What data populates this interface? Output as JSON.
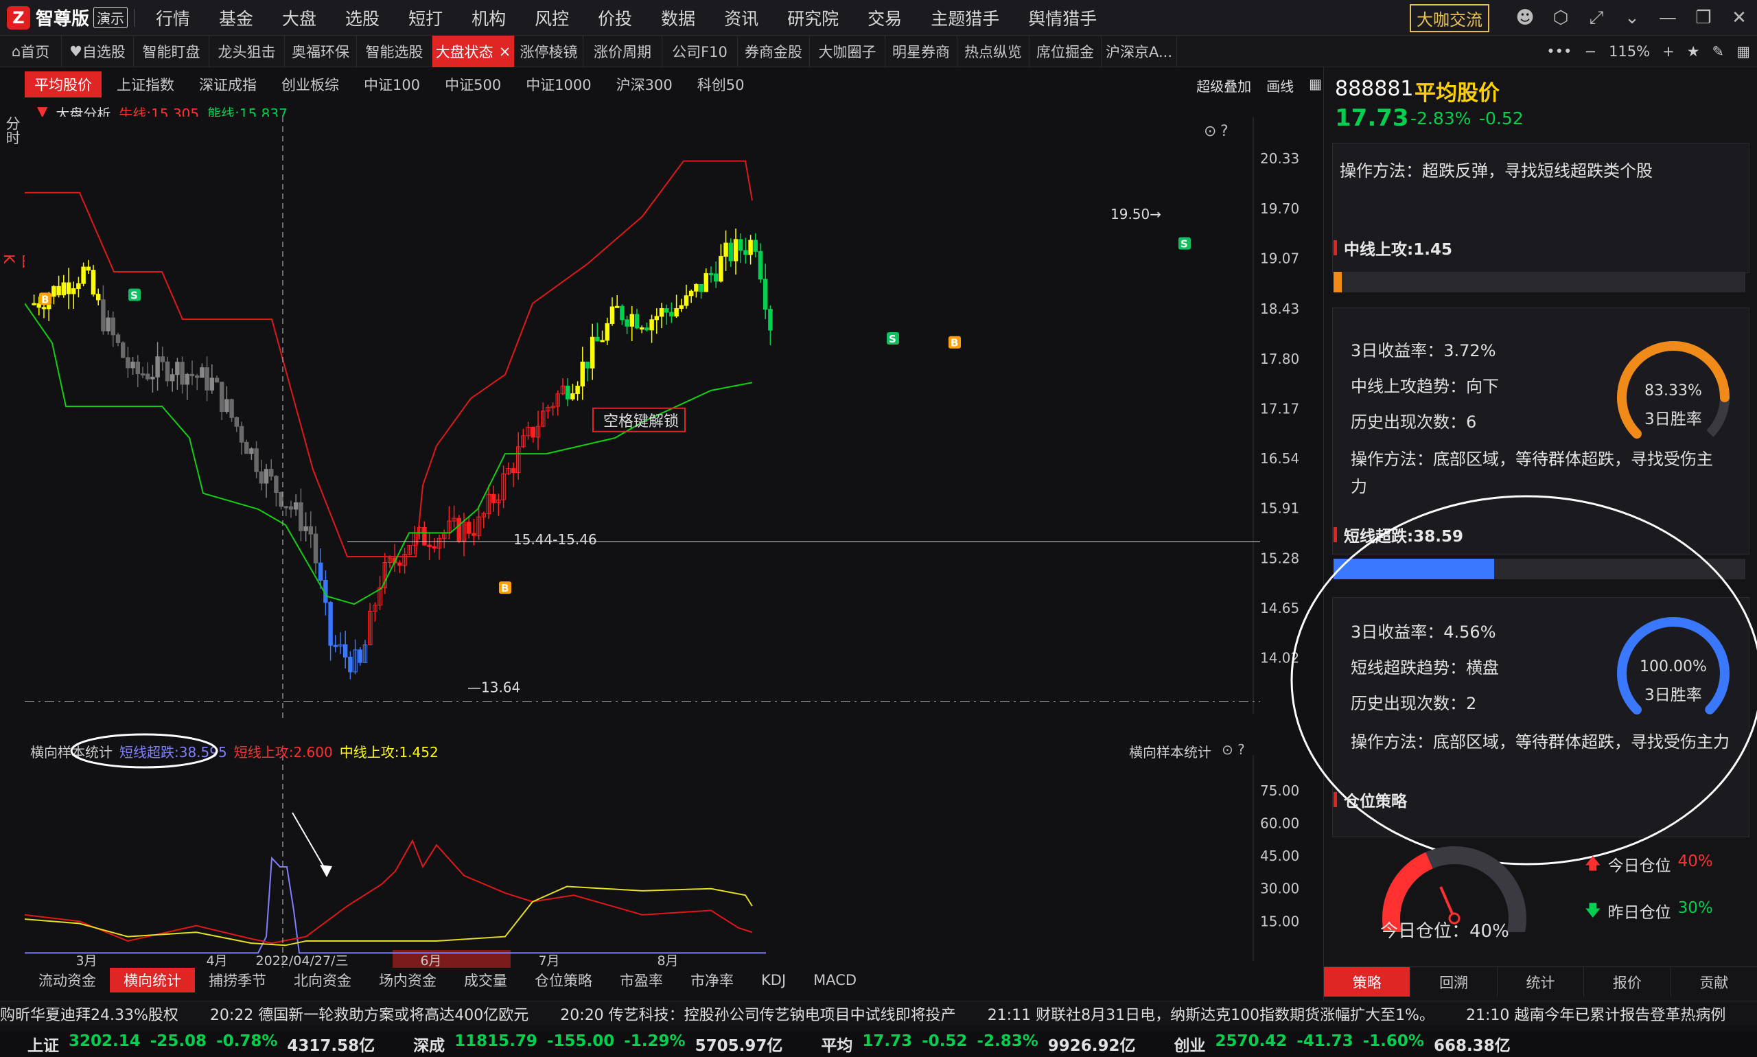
{
  "app": {
    "logo_char": "Z",
    "name": "智尊版",
    "mode": "演示"
  },
  "menu": [
    "行情",
    "基金",
    "大盘",
    "选股",
    "短打",
    "机构",
    "风控",
    "价投",
    "数据",
    "资讯",
    "研究院",
    "交易",
    "主题猎手",
    "舆情猎手"
  ],
  "top_right": {
    "button": "大咖交流"
  },
  "tabs": [
    {
      "label": "首页",
      "icon": "home-icon"
    },
    {
      "label": "自选股",
      "icon": "heart-icon"
    },
    {
      "label": "智能盯盘"
    },
    {
      "label": "龙头狙击"
    },
    {
      "label": "奥福环保"
    },
    {
      "label": "智能选股"
    },
    {
      "label": "大盘状态",
      "active": true,
      "close": "×"
    },
    {
      "label": "涨停棱镜"
    },
    {
      "label": "涨价周期"
    },
    {
      "label": "公司F10"
    },
    {
      "label": "券商金股"
    },
    {
      "label": "大咖圈子"
    },
    {
      "label": "明星券商"
    },
    {
      "label": "热点纵览"
    },
    {
      "label": "席位掘金"
    },
    {
      "label": "沪深京A..."
    }
  ],
  "tab_tools": {
    "more": "•••",
    "zoom": "115%"
  },
  "left_tabs": [
    {
      "label": "分时"
    },
    {
      "label": "日K",
      "active": true
    }
  ],
  "chart_tabs": [
    {
      "label": "平均股价",
      "active": true
    },
    {
      "label": "上证指数"
    },
    {
      "label": "深证成指"
    },
    {
      "label": "创业板综"
    },
    {
      "label": "中证100"
    },
    {
      "label": "中证500"
    },
    {
      "label": "中证1000"
    },
    {
      "label": "沪深300"
    },
    {
      "label": "科创50"
    }
  ],
  "chart_tools": {
    "overlay": "超级叠加",
    "draw": "画线"
  },
  "analysis": {
    "name": "大盘分析",
    "bull_label": "牛线:15.305",
    "bear_label": "熊线:15.837"
  },
  "price_axis": [
    "20.33",
    "19.70",
    "19.07",
    "18.43",
    "17.80",
    "17.17",
    "16.54",
    "15.91",
    "15.28",
    "14.65",
    "14.02"
  ],
  "annotations": {
    "unlock": "空格键解锁",
    "range": "15.44-15.46",
    "low": "13.64",
    "high": "19.50"
  },
  "date_axis": [
    {
      "label": "3月"
    },
    {
      "label": "4月"
    },
    {
      "label": "2022/04/27/三",
      "highlight": true
    },
    {
      "label": "6月"
    },
    {
      "label": "7月"
    },
    {
      "label": "8月"
    }
  ],
  "indicator": {
    "name": "横向样本统计",
    "short_drop": "短线超跌:38.595",
    "short_attack": "短线上攻:2.600",
    "mid_attack": "中线上攻:1.452",
    "right_label": "横向样本统计"
  },
  "ind_axis": [
    "75.00",
    "60.00",
    "45.00",
    "30.00",
    "15.00"
  ],
  "bottom_tabs": [
    {
      "label": "流动资金"
    },
    {
      "label": "横向统计",
      "active": true
    },
    {
      "label": "捕捞季节"
    },
    {
      "label": "北向资金"
    },
    {
      "label": "场内资金"
    },
    {
      "label": "成交量"
    },
    {
      "label": "仓位策略"
    },
    {
      "label": "市盈率"
    },
    {
      "label": "市净率"
    },
    {
      "label": "KDJ"
    },
    {
      "label": "MACD"
    }
  ],
  "ticker": [
    "购昕华夏迪拜24.33%股权",
    "20:22 德国新一轮救助方案或将高达400亿欧元",
    "20:20 传艺科技：控股孙公司传艺钠电项目中试线即将投产",
    "21:11 财联社8月31日电，纳斯达克100指数期货涨幅扩大至1%。",
    "21:10 越南今年已累计报告登革热病例"
  ],
  "status": [
    {
      "name": "上证",
      "price": "3202.14",
      "chg": "-25.08",
      "pct": "-0.78%",
      "amt": "4317.58亿"
    },
    {
      "name": "深成",
      "price": "11815.79",
      "chg": "-155.00",
      "pct": "-1.29%",
      "amt": "5705.97亿"
    },
    {
      "name": "平均",
      "price": "17.73",
      "chg": "-0.52",
      "pct": "-2.83%",
      "amt": "9926.92亿"
    },
    {
      "name": "创业",
      "price": "2570.42",
      "chg": "-41.73",
      "pct": "-1.60%",
      "amt": "668.38亿"
    }
  ],
  "side": {
    "code": "888881",
    "name": "平均股价",
    "price": "17.73",
    "pct": "-2.83%",
    "chg": "-0.52",
    "method_top": "操作方法：超跌反弹，寻找短线超跌类个股",
    "mid": {
      "title": "中线上攻:1.45",
      "level": 0.02,
      "ret": "3日收益率：3.72%",
      "trend": "中线上攻趋势：向下",
      "count": "历史出现次数：6",
      "method1": "操作方法：底部区域，等待群体超跌，寻找受伤主",
      "method2": "力",
      "gauge_pct": "83.33%",
      "gauge_value": 0.8333,
      "gauge_label": "3日胜率",
      "color": "#f08a18"
    },
    "short": {
      "title": "短线超跌:38.59",
      "level": 0.39,
      "ret": "3日收益率：4.56%",
      "trend": "短线超跌趋势：横盘",
      "count": "历史出现次数：2",
      "method": "操作方法：底部区域，等待群体超跌，寻找受伤主力",
      "gauge_pct": "100.00%",
      "gauge_value": 1.0,
      "gauge_label": "3日胜率",
      "color": "#3a78ff"
    },
    "position": {
      "title": "仓位策略",
      "today_label": "今日仓位：40%",
      "today": "今日仓位",
      "today_val": "40%",
      "yesterday": "昨日仓位",
      "yesterday_val": "30%",
      "level": 0.4
    },
    "tabs": [
      {
        "label": "策略",
        "active": true
      },
      {
        "label": "回溯"
      },
      {
        "label": "统计"
      },
      {
        "label": "报价"
      },
      {
        "label": "贡献"
      }
    ]
  },
  "colors": {
    "up": "#ff3030",
    "down": "#00d050",
    "accent": "#e02525",
    "yellow": "#ffff00"
  }
}
